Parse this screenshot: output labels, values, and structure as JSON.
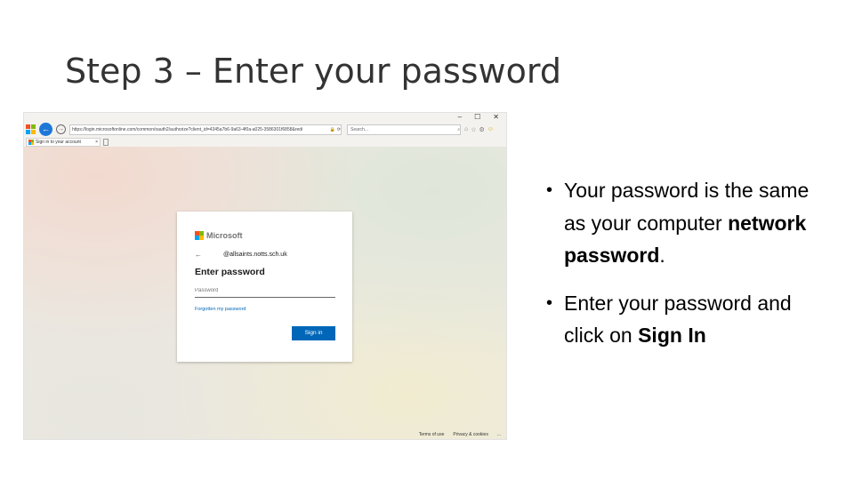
{
  "slide": {
    "title": "Step 3 – Enter your password"
  },
  "browser": {
    "controls": [
      "–",
      "☐",
      "✕"
    ],
    "url": "https://login.microsoftonline.com/common/oauth2/authorize?client_id=4345a7b6-9a63-4f0a-a025-3586301f6858&redi",
    "search_placeholder": "Search...",
    "tab_label": "Sign in to your account",
    "card": {
      "brand": "Microsoft",
      "account": "@allsaints.notts.sch.uk",
      "heading": "Enter password",
      "password_placeholder": "Password",
      "forgot": "Forgotten my password",
      "signin": "Sign in"
    },
    "footer": [
      "Terms of use",
      "Privacy & cookies",
      "..."
    ]
  },
  "bullets": [
    {
      "dot": "•",
      "parts": [
        "Your password is the same as your computer ",
        "network password",
        "."
      ]
    },
    {
      "dot": "•",
      "parts": [
        "Enter your password and click on ",
        "Sign In",
        ""
      ]
    }
  ],
  "colors": {
    "ms_red": "#f25022",
    "ms_green": "#7fba00",
    "ms_blue": "#00a4ef",
    "ms_yellow": "#ffb900",
    "signin_blue": "#0067b8"
  }
}
